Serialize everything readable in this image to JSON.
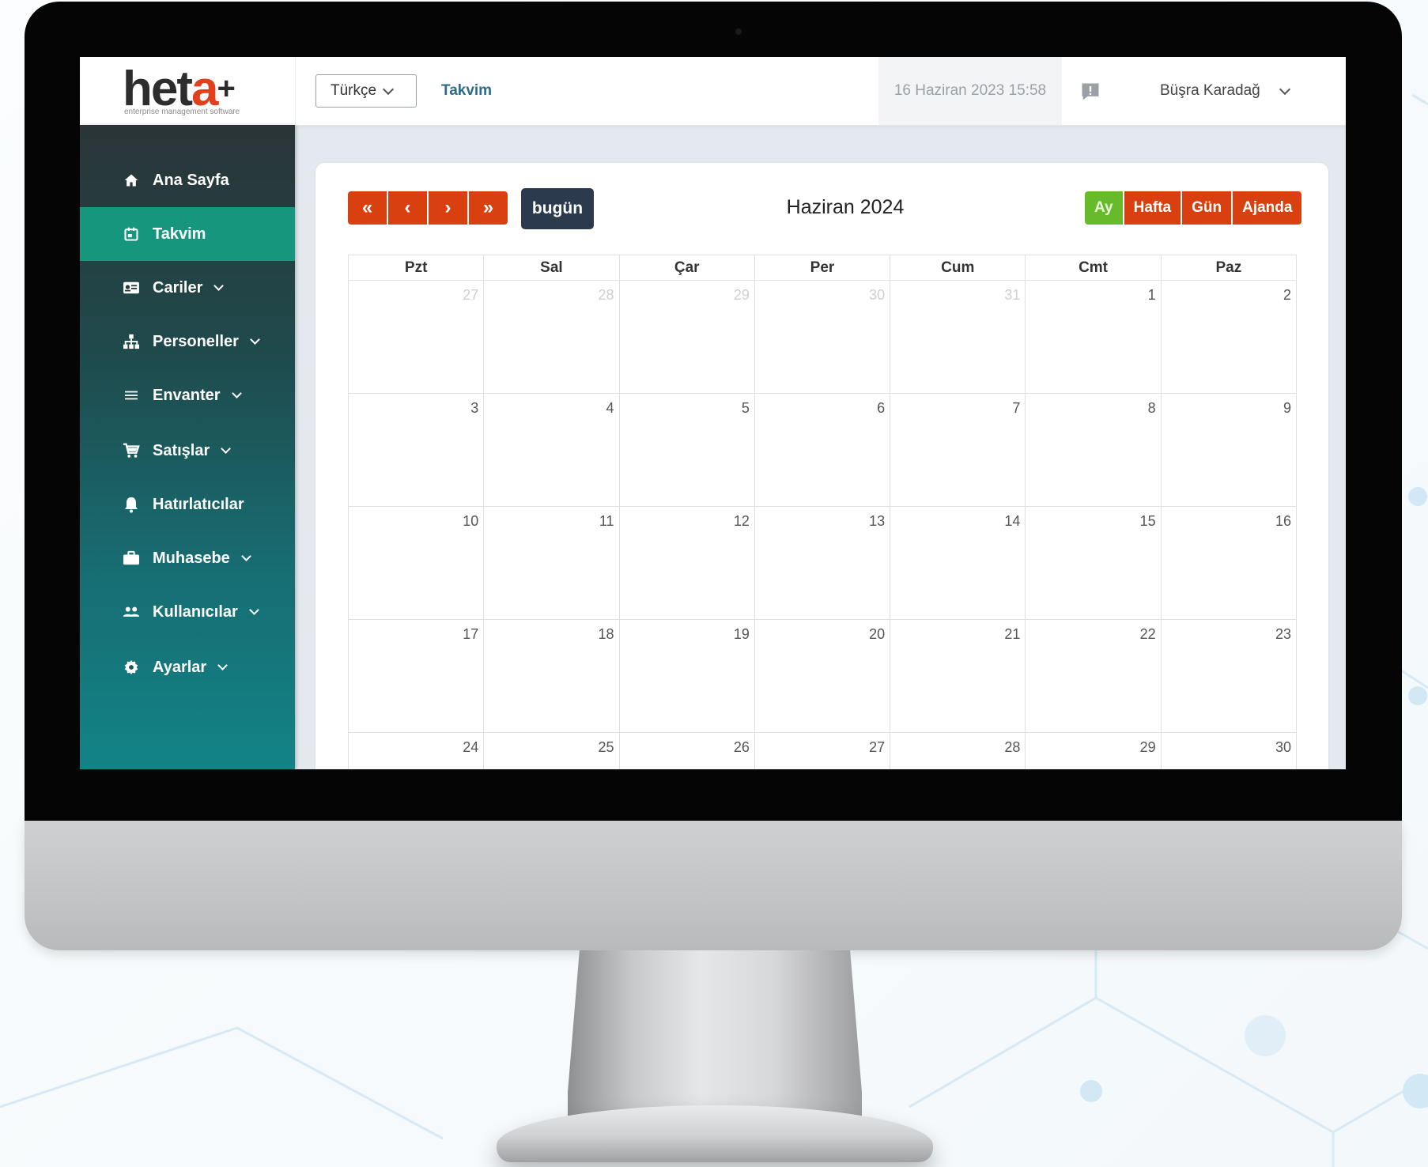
{
  "logo": {
    "name_main": "het",
    "name_accent": "a",
    "name_suffix": "+",
    "tagline": "enterprise management software"
  },
  "topbar": {
    "language": "Türkçe",
    "breadcrumb": "Takvim",
    "datetime": "16 Haziran 2023 15:58",
    "user_name": "Büşra Karadağ"
  },
  "sidebar": {
    "items": [
      {
        "label": "Ana Sayfa",
        "icon": "home-icon",
        "active": false,
        "has_submenu": false
      },
      {
        "label": "Takvim",
        "icon": "calendar-icon",
        "active": true,
        "has_submenu": false
      },
      {
        "label": "Cariler",
        "icon": "id-card-icon",
        "active": false,
        "has_submenu": true
      },
      {
        "label": "Personeller",
        "icon": "org-chart-icon",
        "active": false,
        "has_submenu": true
      },
      {
        "label": "Envanter",
        "icon": "list-icon",
        "active": false,
        "has_submenu": true
      },
      {
        "label": "Satışlar",
        "icon": "cart-icon",
        "active": false,
        "has_submenu": true
      },
      {
        "label": "Hatırlatıcılar",
        "icon": "bell-icon",
        "active": false,
        "has_submenu": false
      },
      {
        "label": "Muhasebe",
        "icon": "briefcase-icon",
        "active": false,
        "has_submenu": true
      },
      {
        "label": "Kullanıcılar",
        "icon": "users-icon",
        "active": false,
        "has_submenu": true
      },
      {
        "label": "Ayarlar",
        "icon": "gear-icon",
        "active": false,
        "has_submenu": true
      }
    ]
  },
  "calendar": {
    "nav_buttons": [
      "«",
      "‹",
      "›",
      "»"
    ],
    "today_label": "bugün",
    "title": "Haziran 2024",
    "views": [
      {
        "label": "Ay",
        "active": true
      },
      {
        "label": "Hafta",
        "active": false
      },
      {
        "label": "Gün",
        "active": false
      },
      {
        "label": "Ajanda",
        "active": false
      }
    ],
    "weekdays": [
      "Pzt",
      "Sal",
      "Çar",
      "Per",
      "Cum",
      "Cmt",
      "Paz"
    ],
    "weeks": [
      [
        {
          "d": "27",
          "other": true
        },
        {
          "d": "28",
          "other": true
        },
        {
          "d": "29",
          "other": true
        },
        {
          "d": "30",
          "other": true
        },
        {
          "d": "31",
          "other": true
        },
        {
          "d": "1",
          "other": false
        },
        {
          "d": "2",
          "other": false
        }
      ],
      [
        {
          "d": "3",
          "other": false
        },
        {
          "d": "4",
          "other": false
        },
        {
          "d": "5",
          "other": false
        },
        {
          "d": "6",
          "other": false
        },
        {
          "d": "7",
          "other": false
        },
        {
          "d": "8",
          "other": false
        },
        {
          "d": "9",
          "other": false
        }
      ],
      [
        {
          "d": "10",
          "other": false
        },
        {
          "d": "11",
          "other": false
        },
        {
          "d": "12",
          "other": false
        },
        {
          "d": "13",
          "other": false
        },
        {
          "d": "14",
          "other": false
        },
        {
          "d": "15",
          "other": false
        },
        {
          "d": "16",
          "other": false
        }
      ],
      [
        {
          "d": "17",
          "other": false
        },
        {
          "d": "18",
          "other": false
        },
        {
          "d": "19",
          "other": false
        },
        {
          "d": "20",
          "other": false
        },
        {
          "d": "21",
          "other": false
        },
        {
          "d": "22",
          "other": false
        },
        {
          "d": "23",
          "other": false
        }
      ],
      [
        {
          "d": "24",
          "other": false
        },
        {
          "d": "25",
          "other": false
        },
        {
          "d": "26",
          "other": false
        },
        {
          "d": "27",
          "other": false
        },
        {
          "d": "28",
          "other": false
        },
        {
          "d": "29",
          "other": false
        },
        {
          "d": "30",
          "other": false
        }
      ]
    ]
  },
  "colors": {
    "accent_orange": "#d9400f",
    "active_green": "#67bb2a",
    "sidebar_active": "#16977d",
    "today_button": "#2b3a4d"
  }
}
